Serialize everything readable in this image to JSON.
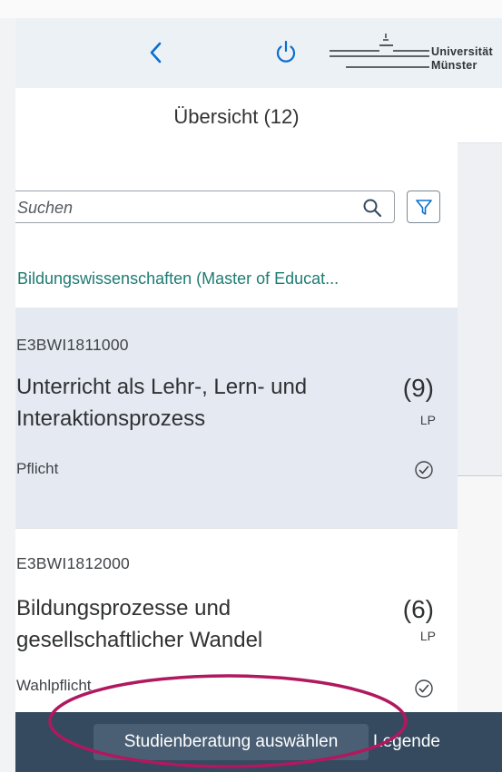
{
  "shell": {
    "back_icon": "chevron-left-icon",
    "power_icon": "power-icon",
    "logo": {
      "line1": "Universität",
      "line2": "Münster"
    }
  },
  "panel": {
    "title": "Übersicht (12)",
    "search": {
      "placeholder": "Suchen",
      "value": ""
    },
    "group_header": "Bildungswissenschaften (Master of Educat...",
    "items": [
      {
        "code": "E3BWI1811000",
        "title": "Unterricht als Lehr-, Lern- und Interaktionsprozess",
        "status": "Pflicht",
        "credits": "(9)",
        "unit": "LP",
        "selected": true
      },
      {
        "code": "E3BWI1812000",
        "title": "Bildungsprozesse und gesellschaftlicher Wandel",
        "status": "Wahlpflicht",
        "credits": "(6)",
        "unit": "LP",
        "selected": false
      }
    ]
  },
  "footer": {
    "primary_button": "Studienberatung auswählen",
    "legend_button": "Legende"
  },
  "colors": {
    "shell_bg": "#ecf1f6",
    "footer_bg": "#354a5f",
    "group_header": "#1e7c72",
    "selected_bg": "#e5eaf2",
    "annotation": "#b0185f"
  }
}
